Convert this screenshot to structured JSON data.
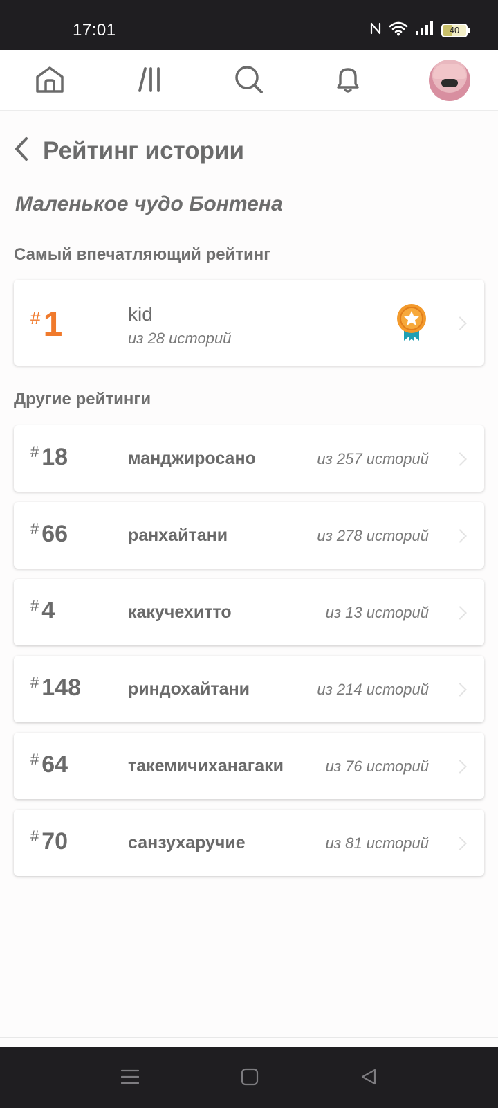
{
  "status_bar": {
    "time": "17:01",
    "battery": "40",
    "icons": [
      "nfc-icon",
      "wifi-icon",
      "signal-icon",
      "battery-icon"
    ]
  },
  "top_nav": {
    "items": [
      "home-icon",
      "library-icon",
      "search-icon",
      "bell-icon",
      "avatar"
    ]
  },
  "header": {
    "title": "Рейтинг истории",
    "back_icon": "chevron-left-icon"
  },
  "story": {
    "title": "Маленькое чудо Бонтена"
  },
  "best_section": {
    "label": "Самый впечатляющий рейтинг",
    "item": {
      "hash": "#",
      "rank": "1",
      "tag": "kid",
      "count": "из 28 историй",
      "badge_icon": "award-star-icon"
    }
  },
  "other_section": {
    "label": "Другие рейтинги",
    "items": [
      {
        "hash": "#",
        "rank": "18",
        "tag": "манджиросано",
        "count": "из 257 историй"
      },
      {
        "hash": "#",
        "rank": "66",
        "tag": "ранхайтани",
        "count": "из 278 историй"
      },
      {
        "hash": "#",
        "rank": "4",
        "tag": "какучехитто",
        "count": "из 13 историй"
      },
      {
        "hash": "#",
        "rank": "148",
        "tag": "риндохайтани",
        "count": "из 214 историй"
      },
      {
        "hash": "#",
        "rank": "64",
        "tag": "такемичиханагаки",
        "count": "из 76 историй"
      },
      {
        "hash": "#",
        "rank": "70",
        "tag": "санзухаручие",
        "count": "из 81 историй"
      }
    ]
  },
  "colors": {
    "accent": "#f07a2c",
    "badge_ribbon": "#1f9fb3",
    "text": "#6b6b6b",
    "status_bar": "#1f1e21"
  }
}
